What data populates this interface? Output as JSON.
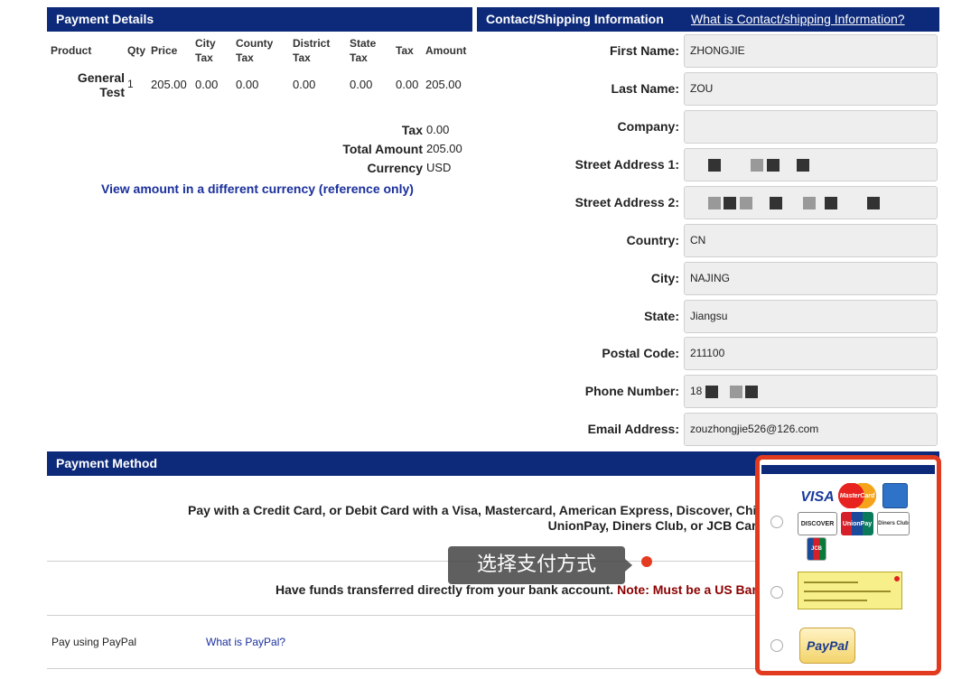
{
  "payment_details": {
    "title": "Payment Details",
    "columns": [
      "Product",
      "Qty",
      "Price",
      "City Tax",
      "County Tax",
      "District Tax",
      "State Tax",
      "Tax",
      "Amount"
    ],
    "row": {
      "product": "General Test",
      "qty": "1",
      "price": "205.00",
      "city_tax": "0.00",
      "county_tax": "0.00",
      "district_tax": "0.00",
      "state_tax": "0.00",
      "tax": "0.00",
      "amount": "205.00"
    },
    "summary": {
      "tax_label": "Tax",
      "tax_value": "0.00",
      "total_label": "Total Amount",
      "total_value": "205.00",
      "currency_label": "Currency",
      "currency_value": "USD"
    },
    "currency_link": "View amount in a different currency (reference only)"
  },
  "contact": {
    "title": "Contact/Shipping Information",
    "help_link": "What is Contact/shipping Information?",
    "fields": [
      {
        "label": "First Name:",
        "value": "ZHONGJIE"
      },
      {
        "label": "Last Name:",
        "value": "ZOU"
      },
      {
        "label": "Company:",
        "value": ""
      },
      {
        "label": "Street Address 1:",
        "value": ""
      },
      {
        "label": "Street Address 2:",
        "value": ""
      },
      {
        "label": "Country:",
        "value": "CN"
      },
      {
        "label": "City:",
        "value": "NAJING"
      },
      {
        "label": "State:",
        "value": "Jiangsu"
      },
      {
        "label": "Postal Code:",
        "value": "211100"
      },
      {
        "label": "Phone Number:",
        "value": "18"
      },
      {
        "label": "Email Address:",
        "value": "zouzhongjie526@126.com"
      }
    ]
  },
  "payment_method": {
    "title": "Payment Method",
    "card_text_1": "Pay with a Credit Card, or Debit Card with a Visa, Mastercard, American Express, Discover, Chin",
    "card_text_2": "UnionPay, Diners Club, or JCB Card",
    "bank_text": "Have funds transferred directly from your bank account.",
    "bank_note": "Note: Must be a US Ban",
    "paypal_text": "Pay using PayPal",
    "paypal_link": "What is PayPal?",
    "annotation": "选择支付方式",
    "card_logos": {
      "visa": "VISA",
      "mastercard": "MasterCard",
      "discover": "DISCOVER",
      "unionpay": "UnionPay",
      "diners": "Diners Club",
      "jcb": "JCB",
      "paypal": "PayPal"
    }
  },
  "colors": {
    "header_bg": "#0d2a7a",
    "highlight_border": "#e23a1e",
    "note_red": "#8b0000"
  }
}
